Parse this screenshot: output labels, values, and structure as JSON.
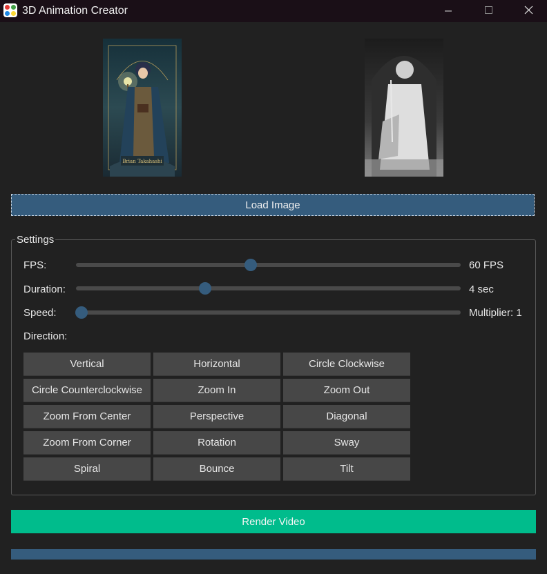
{
  "window": {
    "title": "3D Animation Creator",
    "controls": [
      "minimize-icon",
      "maximize-icon",
      "close-icon"
    ]
  },
  "images": {
    "left_signature": "Brian Takahashi"
  },
  "load_button": {
    "label": "Load Image"
  },
  "settings": {
    "legend": "Settings",
    "fps": {
      "label": "FPS:",
      "value_text": "60 FPS",
      "fraction": 0.455
    },
    "duration": {
      "label": "Duration:",
      "value_text": "4 sec",
      "fraction": 0.335
    },
    "speed": {
      "label": "Speed:",
      "value_text": "Multiplier: 1",
      "fraction": 0.015
    },
    "direction_label": "Direction:",
    "directions": [
      "Vertical",
      "Horizontal",
      "Circle Clockwise",
      "Circle Counterclockwise",
      "Zoom In",
      "Zoom Out",
      "Zoom From Center",
      "Perspective",
      "Diagonal",
      "Zoom From Corner",
      "Rotation",
      "Sway",
      "Spiral",
      "Bounce",
      "Tilt"
    ]
  },
  "render_button": {
    "label": "Render Video"
  },
  "progress": {
    "fraction": 1.0
  },
  "colors": {
    "accent": "#355c7d",
    "success": "#00bc8c",
    "background": "#212121",
    "button": "#474747"
  }
}
